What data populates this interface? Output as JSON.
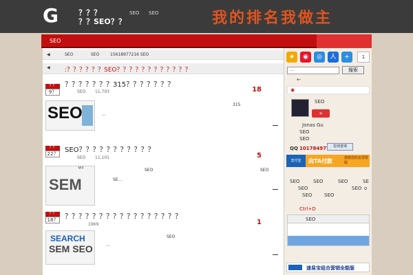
{
  "header": {
    "logo_letter": "G",
    "logo_line1": "？？？",
    "logo_line2": "？？SEO？？",
    "link1": "SEO",
    "link2": "SEO",
    "slogan": "我的排名我做主"
  },
  "nav": {
    "item": "SEO"
  },
  "breadcrumb": {
    "a": "SEO",
    "b": "SEO",
    "c": "15618977216 SEO"
  },
  "notice": ":？？？？？？SEO？？？？？？？？？？？？",
  "posts": [
    {
      "month": "？？",
      "day": "9？",
      "title": "？？？？？？？315？？？？？？？",
      "meta_a": "SEO",
      "meta_b": "11,793",
      "count": "18",
      "text": "315",
      "excerpt": "..."
    },
    {
      "month": "？？",
      "day": "22？",
      "title": "SEO？？？？？？？？？？？",
      "meta_a": "SEO",
      "meta_b": "11,101",
      "count": "5",
      "text": "SEO",
      "text2": "SEO",
      "excerpt": "SE..."
    },
    {
      "month": "？？",
      "day": "18？",
      "title": "？？？？？？？？？？？？？？？？？",
      "meta_b": "1969",
      "count": "1",
      "text": "SEO",
      "excerpt": "..."
    }
  ],
  "sidebar": {
    "share_count": "1",
    "search_placeholder": "...",
    "search_button": "搜索",
    "arrow": "←",
    "profile_name": "SEO",
    "add_label": "+",
    "author": "Jonas Gu",
    "line_seo1": "SEO",
    "line_seo2": "SEO",
    "qq_label": "QQ",
    "qq_number": "101784977",
    "qq_button": "在线咨询",
    "pay_label": "向TA付款",
    "pay_thanks": "感谢您的友情赞助",
    "tags": [
      "SEO",
      "SEO",
      "SEO",
      "SE",
      "SEO",
      "SEO",
      "SEO",
      "SEO",
      "o"
    ],
    "shortcut": "Ctrl+D",
    "box_title": "SEO",
    "ad_text": "速易宝组合营销全能版"
  }
}
